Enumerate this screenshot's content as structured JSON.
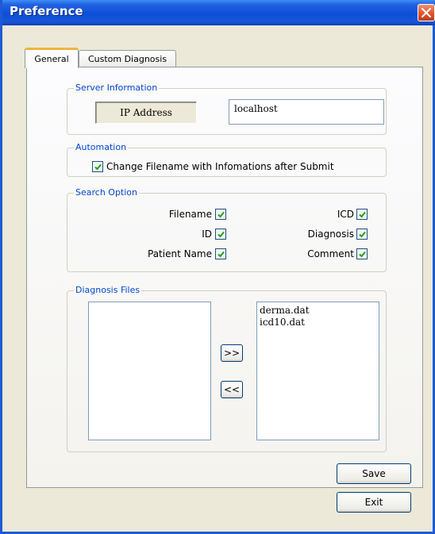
{
  "window": {
    "title": "Preference"
  },
  "tabs": [
    {
      "label": "General",
      "selected": true
    },
    {
      "label": "Custom Diagnosis",
      "selected": false
    }
  ],
  "server_info": {
    "group_title": "Server Information",
    "ip_label": "IP Address",
    "ip_value": "localhost"
  },
  "automation": {
    "group_title": "Automation",
    "option": {
      "label": "Change Filename with Infomations after Submit",
      "checked": true
    }
  },
  "search_option": {
    "group_title": "Search Option",
    "left": [
      {
        "label": "Filename",
        "checked": true
      },
      {
        "label": "ID",
        "checked": true
      },
      {
        "label": "Patient Name",
        "checked": true
      }
    ],
    "right": [
      {
        "label": "ICD",
        "checked": true
      },
      {
        "label": "Diagnosis",
        "checked": true
      },
      {
        "label": "Comment",
        "checked": true
      }
    ]
  },
  "diagnosis_files": {
    "group_title": "Diagnosis Files",
    "available": [],
    "selected": [
      "derma.dat",
      "icd10.dat"
    ],
    "add_label": ">>",
    "remove_label": "<<"
  },
  "buttons": {
    "save": "Save",
    "exit": "Exit"
  },
  "colors": {
    "title_bar": "#0b4fd6",
    "group_title": "#0046d5",
    "tab_highlight": "#f2b43c",
    "close": "#e0522c"
  }
}
